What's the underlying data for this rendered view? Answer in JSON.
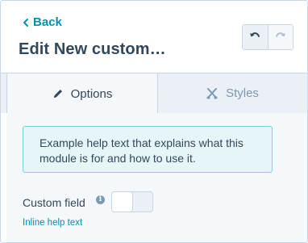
{
  "header": {
    "back_label": "Back",
    "title": "Edit New custom…"
  },
  "history": {
    "undo_icon": "undo-icon",
    "redo_icon": "redo-icon"
  },
  "tabs": [
    {
      "label": "Options",
      "icon": "pencil-icon",
      "active": true
    },
    {
      "label": "Styles",
      "icon": "styles-icon",
      "active": false
    }
  ],
  "help_text": "Example help text that explains what this module is for and how to use it.",
  "field": {
    "label": "Custom field",
    "info_icon": "info-icon",
    "toggle_on": false,
    "inline_help": "Inline help text"
  },
  "colors": {
    "accent": "#0091ae",
    "text": "#33475b",
    "muted": "#7c98b6",
    "help_bg": "#e5f5f8",
    "help_border": "#7fd1de"
  }
}
